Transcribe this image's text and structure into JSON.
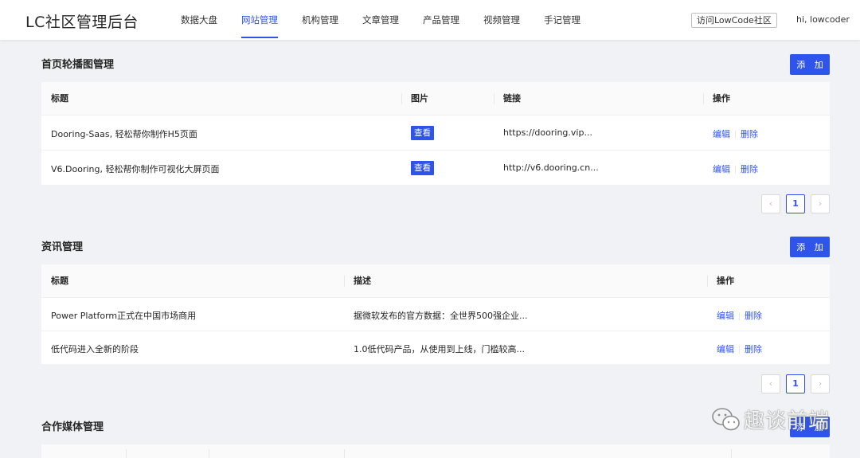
{
  "header": {
    "logo": "LC社区管理后台",
    "nav": [
      "数据大盘",
      "网站管理",
      "机构管理",
      "文章管理",
      "产品管理",
      "视频管理",
      "手记管理"
    ],
    "active_nav": "网站管理",
    "visit_label": "访问LowCode社区",
    "user_label": "hi, lowcoder"
  },
  "carousel": {
    "title": "首页轮播图管理",
    "add_label": "添 加",
    "columns": [
      "标题",
      "图片",
      "链接",
      "操作"
    ],
    "rows": [
      {
        "title": "Dooring-Saas, 轻松帮你制作H5页面",
        "image": "查看",
        "link": "https://dooring.vip...",
        "edit": "编辑",
        "delete": "删除"
      },
      {
        "title": "V6.Dooring, 轻松帮你制作可视化大屏页面",
        "image": "查看",
        "link": "http://v6.dooring.cn...",
        "edit": "编辑",
        "delete": "删除"
      }
    ],
    "pager": {
      "prev": "‹",
      "page": "1",
      "next": "›"
    }
  },
  "news": {
    "title": "资讯管理",
    "add_label": "添 加",
    "columns": [
      "标题",
      "描述",
      "操作"
    ],
    "rows": [
      {
        "title": "Power Platform正式在中国市场商用",
        "desc": "据微软发布的官方数据：全世界500强企业...",
        "edit": "编辑",
        "delete": "删除"
      },
      {
        "title": "低代码进入全新的阶段",
        "desc": "1.0低代码产品，从使用到上线，门槛较高...",
        "edit": "编辑",
        "delete": "删除"
      }
    ],
    "pager": {
      "prev": "‹",
      "page": "1",
      "next": "›"
    }
  },
  "media": {
    "title": "合作媒体管理",
    "add_label": "添 加"
  },
  "watermark": {
    "text": "趣谈前端"
  },
  "colors": {
    "primary": "#2f54eb",
    "background": "#f0f2f5"
  }
}
